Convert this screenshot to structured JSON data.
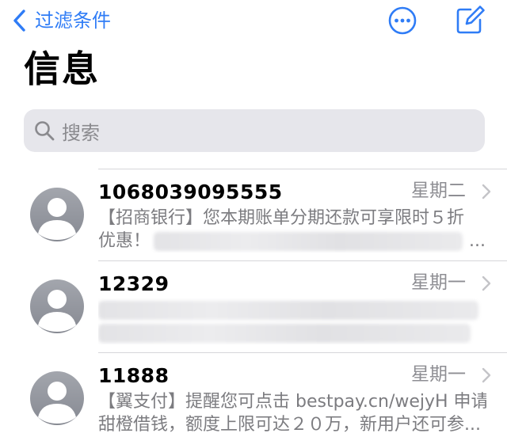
{
  "nav": {
    "back_label": "过滤条件"
  },
  "title": "信息",
  "search": {
    "placeholder": "搜索"
  },
  "messages": [
    {
      "sender": "1068039095555",
      "date": "星期二",
      "preview_line1": "【招商银行】您本期账单分期还款可享限时５折",
      "preview_line2_start": "优惠！",
      "preview_line2_end": "..."
    },
    {
      "sender": "12329",
      "date": "星期一"
    },
    {
      "sender": "11888",
      "date": "星期一",
      "preview_line1": "【翼支付】提醒您可点击 bestpay.cn/wejyH 申请",
      "preview_line2_start": "甜橙借钱，额度上限可达２０万，新用户还可参..."
    }
  ],
  "icons": {
    "back": "chevron-left-icon",
    "more": "ellipsis-circle-icon",
    "compose": "compose-icon",
    "search": "magnifying-glass-icon",
    "avatar": "person-silhouette-icon",
    "disclosure": "chevron-right-icon"
  },
  "colors": {
    "accent": "#2f7cf6",
    "secondary_text": "#8e8e93",
    "search_background": "#e6e6eb",
    "avatar_gradient_top": "#a3a6ad",
    "avatar_gradient_bottom": "#868992"
  }
}
